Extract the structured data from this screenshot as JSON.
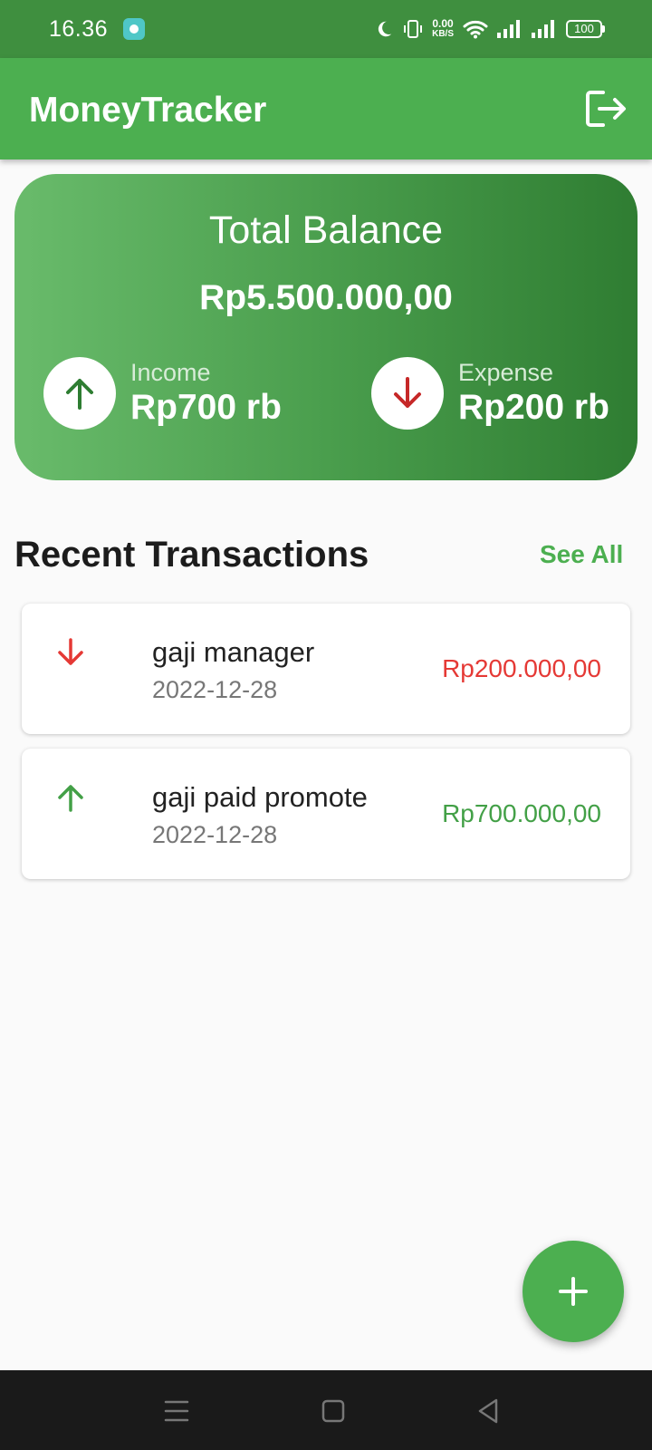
{
  "status_bar": {
    "time": "16.36",
    "net_speed": "0.00",
    "net_unit": "KB/S",
    "battery": "100",
    "icons": [
      "app-notification-icon",
      "moon-icon",
      "vibrate-icon",
      "wifi-icon",
      "signal-icon",
      "signal-icon",
      "battery-icon"
    ]
  },
  "app_bar": {
    "title": "MoneyTracker",
    "logout_icon": "logout-icon"
  },
  "balance": {
    "label": "Total Balance",
    "amount": "Rp5.500.000,00",
    "income": {
      "label": "Income",
      "value": "Rp700 rb",
      "icon": "arrow-up-icon",
      "color": "#2e7d32"
    },
    "expense": {
      "label": "Expense",
      "value": "Rp200 rb",
      "icon": "arrow-down-icon",
      "color": "#c62828"
    }
  },
  "recent": {
    "title": "Recent Transactions",
    "see_all": "See All",
    "items": [
      {
        "name": "gaji manager",
        "date": "2022-12-28",
        "amount": "Rp200.000,00",
        "type": "expense",
        "icon": "arrow-down-icon",
        "color": "#e53935"
      },
      {
        "name": "gaji paid promote",
        "date": "2022-12-28",
        "amount": "Rp700.000,00",
        "type": "income",
        "icon": "arrow-up-icon",
        "color": "#43a047"
      }
    ]
  },
  "fab": {
    "icon": "plus-icon"
  },
  "nav": {
    "icons": [
      "menu-icon",
      "home-icon",
      "back-icon"
    ]
  },
  "colors": {
    "primary": "#4caf50",
    "status_bar": "#3f8f3f",
    "income": "#43a047",
    "expense": "#e53935"
  }
}
